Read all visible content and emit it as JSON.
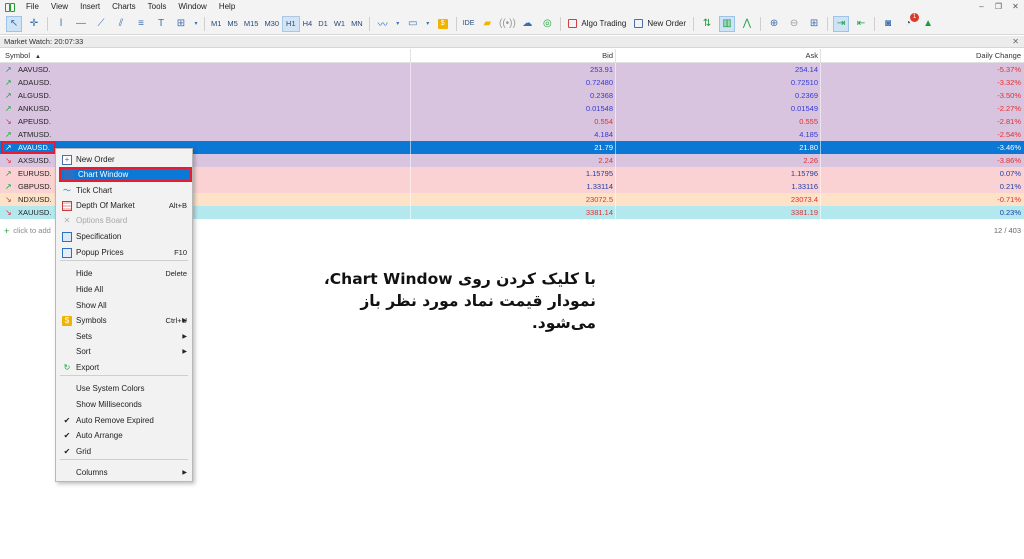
{
  "menubar": {
    "items": [
      "File",
      "View",
      "Insert",
      "Charts",
      "Tools",
      "Window",
      "Help"
    ],
    "window_controls": [
      "–",
      "❐",
      "✕"
    ]
  },
  "toolbar": {
    "timeframes": [
      "M1",
      "M5",
      "M15",
      "M30",
      "H1",
      "H4",
      "D1",
      "W1",
      "MN"
    ],
    "active_timeframe": "H1",
    "ide_label": "IDE",
    "algo_trading_label": "Algo Trading",
    "new_order_label": "New Order",
    "notification_count": "1"
  },
  "market_watch": {
    "title": "Market Watch: 20:07:33",
    "close": "✕",
    "columns": [
      "Symbol",
      "Bid",
      "Ask",
      "Daily Change"
    ],
    "rows": [
      {
        "symbol": "AAVUSD.",
        "bid": "253.91",
        "ask": "254.14",
        "change": "-5.37%",
        "dir": "up",
        "bg": "purple"
      },
      {
        "symbol": "ADAUSD.",
        "bid": "0.72480",
        "ask": "0.72510",
        "change": "-3.32%",
        "dir": "up",
        "bg": "purple"
      },
      {
        "symbol": "ALGUSD.",
        "bid": "0.2368",
        "ask": "0.2369",
        "change": "-3.50%",
        "dir": "up",
        "bg": "purple"
      },
      {
        "symbol": "ANKUSD.",
        "bid": "0.01548",
        "ask": "0.01549",
        "change": "-2.27%",
        "dir": "up",
        "bg": "purple"
      },
      {
        "symbol": "APEUSD.",
        "bid": "0.554",
        "ask": "0.555",
        "change": "-2.81%",
        "dir": "down",
        "bg": "purple"
      },
      {
        "symbol": "ATMUSD.",
        "bid": "4.184",
        "ask": "4.185",
        "change": "-2.54%",
        "dir": "up",
        "bg": "purple"
      },
      {
        "symbol": "AVAUSD.",
        "bid": "21.79",
        "ask": "21.80",
        "change": "-3.46%",
        "dir": "up",
        "bg": "selected"
      },
      {
        "symbol": "AXSUSD.",
        "bid": "2.24",
        "ask": "2.26",
        "change": "-3.86%",
        "dir": "down",
        "bg": "purple"
      },
      {
        "symbol": "EURUSD.",
        "bid": "1.15795",
        "ask": "1.15796",
        "change": "0.07%",
        "dir": "up",
        "bg": "pink"
      },
      {
        "symbol": "GBPUSD.",
        "bid": "1.33114",
        "ask": "1.33116",
        "change": "0.21%",
        "dir": "up",
        "bg": "pink"
      },
      {
        "symbol": "NDXUSD.",
        "bid": "23072.5",
        "ask": "23073.4",
        "change": "-0.71%",
        "dir": "down",
        "bg": "peach"
      },
      {
        "symbol": "XAUUSD.",
        "bid": "3381.14",
        "ask": "3381.19",
        "change": "0.23%",
        "dir": "down",
        "bg": "cyan"
      }
    ],
    "add_symbol_placeholder": "click to add",
    "count": "12 / 403"
  },
  "context_menu": {
    "items": [
      {
        "label": "New Order",
        "shortcut": "",
        "icon": "new-order-icon"
      },
      {
        "label": "Chart Window",
        "shortcut": "",
        "icon": "chart-window-icon"
      },
      {
        "label": "Tick Chart",
        "shortcut": "",
        "icon": "tick-chart-icon"
      },
      {
        "label": "Depth Of Market",
        "shortcut": "Alt+B",
        "icon": "depth-of-market-icon"
      },
      {
        "label": "Options Board",
        "shortcut": "",
        "icon": "options-board-icon"
      },
      {
        "label": "Specification",
        "shortcut": "",
        "icon": "specification-icon"
      },
      {
        "label": "Popup Prices",
        "shortcut": "F10",
        "icon": "popup-prices-icon"
      },
      {
        "label": "Hide",
        "shortcut": "Delete",
        "icon": ""
      },
      {
        "label": "Hide All",
        "shortcut": "",
        "icon": ""
      },
      {
        "label": "Show All",
        "shortcut": "",
        "icon": ""
      },
      {
        "label": "Symbols",
        "shortcut": "Ctrl+U",
        "icon": "symbols-icon"
      },
      {
        "label": "Sets",
        "shortcut": "",
        "icon": ""
      },
      {
        "label": "Sort",
        "shortcut": "",
        "icon": ""
      },
      {
        "label": "Export",
        "shortcut": "",
        "icon": "export-icon"
      },
      {
        "label": "Use System Colors",
        "shortcut": "",
        "icon": ""
      },
      {
        "label": "Show Milliseconds",
        "shortcut": "",
        "icon": ""
      },
      {
        "label": "Auto Remove Expired",
        "shortcut": "",
        "icon": "check-icon"
      },
      {
        "label": "Auto Arrange",
        "shortcut": "",
        "icon": "check-icon"
      },
      {
        "label": "Grid",
        "shortcut": "",
        "icon": "check-icon"
      },
      {
        "label": "Columns",
        "shortcut": "",
        "icon": ""
      }
    ],
    "highlighted": "Chart Window"
  },
  "annotation": {
    "line1": "با کلیک کردن روی Chart Window،",
    "line2": "نمودار قیمت نماد مورد نظر باز می‌شود."
  },
  "colors": {
    "selection": "#0a78d4",
    "highlight_border": "#e81c2e",
    "row_purple": "#d9c4df",
    "row_pink": "#fbd2d3",
    "row_peach": "#fde2c8",
    "row_cyan": "#b3e9ee"
  }
}
